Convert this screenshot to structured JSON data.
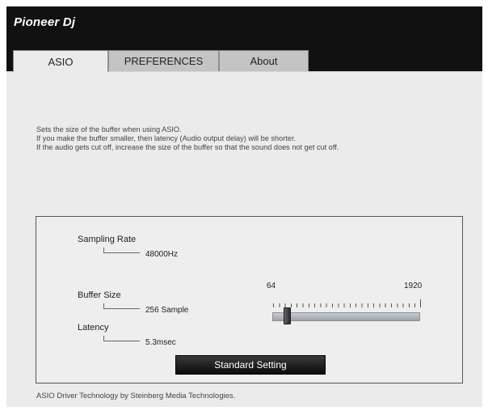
{
  "app": {
    "logo": "Pioneer Dj"
  },
  "tabs": [
    {
      "label": "ASIO",
      "active": true
    },
    {
      "label": "PREFERENCES",
      "active": false
    },
    {
      "label": "About",
      "active": false
    }
  ],
  "description": [
    "Sets the size of the buffer when using ASIO.",
    "If you make the buffer smaller, then latency (Audio output delay) will be shorter.",
    "If the audio gets cut off, increase the size of the buffer so that the sound does not get cut off."
  ],
  "settings": {
    "sampling_rate": {
      "label": "Sampling Rate",
      "value": "48000Hz"
    },
    "buffer_size": {
      "label": "Buffer Size",
      "value": "256 Sample"
    },
    "latency": {
      "label": "Latency",
      "value": "5.3msec"
    }
  },
  "slider": {
    "min_label": "64",
    "max_label": "1920",
    "position_fraction": 0.1
  },
  "buttons": {
    "standard_setting": "Standard Setting"
  },
  "footer": "ASIO Driver Technology by Steinberg Media Technologies.",
  "colors": {
    "header": "#111111",
    "panel_bg": "#ebebeb",
    "button": "#1a1a1a"
  }
}
